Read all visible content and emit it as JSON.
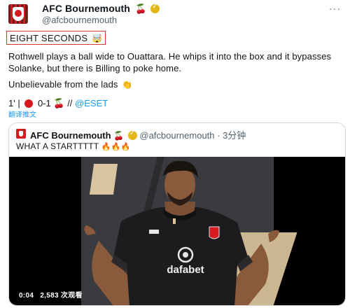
{
  "author": {
    "name": "AFC Bournemouth",
    "handle": "@afcbournemouth",
    "icons": [
      "cherry-icon",
      "verified-icon"
    ]
  },
  "header": {
    "more_label": "···"
  },
  "tweet": {
    "headline": "EIGHT SECONDS",
    "headline_emoji": "🤯",
    "body": "Rothwell plays a ball wide to Ouattara. He whips it into the box and it bypasses Solanke, but there is Billing to poke home.",
    "body2": "Unbelievable from the lads",
    "body2_emoji": "👏",
    "score_prefix": "1' |",
    "score": "0-1",
    "score_suffix": "//",
    "sponsor_link": "@ESET",
    "translate_label": "翻译推文"
  },
  "quote": {
    "name": "AFC Bournemouth",
    "handle_time": "@afcbournemouth · 3分钟",
    "text": "WHAT A STARTTTTT",
    "emojis": "🔥🔥🔥",
    "video": {
      "time": "0:04",
      "views": "2,583 次观看",
      "shirt_sponsor": "dafabet"
    }
  },
  "colors": {
    "accent": "#1d9bf0",
    "brand_red": "#d71920",
    "highlight_border": "#d23a2a",
    "secondary_text": "#536471"
  }
}
